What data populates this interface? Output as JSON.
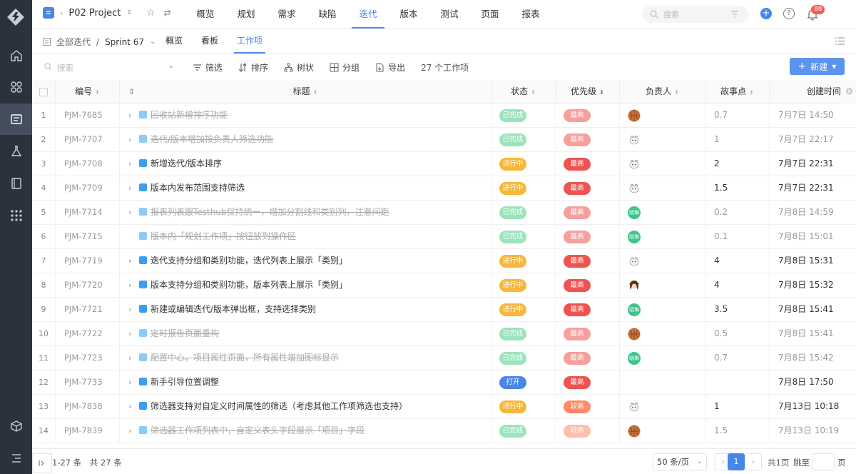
{
  "topbar": {
    "project_name": "P02 Project",
    "tabs": [
      "概览",
      "规划",
      "需求",
      "缺陷",
      "迭代",
      "版本",
      "测试",
      "页面",
      "报表"
    ],
    "active_tab": 4,
    "search_placeholder": "搜索",
    "notification_count": "88"
  },
  "subbar": {
    "breadcrumb_root": "全部迭代",
    "breadcrumb_sep": "/",
    "breadcrumb_current": "Sprint 67",
    "tabs": [
      "概览",
      "看板",
      "工作项"
    ],
    "active_tab": 2
  },
  "toolbar": {
    "search_placeholder": "搜索",
    "filter_label": "筛选",
    "sort_label": "排序",
    "tree_label": "树状",
    "group_label": "分组",
    "export_label": "导出",
    "count_text": "27 个工作项",
    "new_label": "新建"
  },
  "table": {
    "headers": {
      "code": "编号",
      "title": "标题",
      "status": "状态",
      "priority": "优先级",
      "assignee": "负责人",
      "points": "故事点",
      "created": "创建时间"
    },
    "status_colors": {
      "已完成": "#4ccf86",
      "进行中": "#f7b73c",
      "打开": "#4a86e8"
    },
    "priority_colors": {
      "最高": "#ef5350",
      "较高": "#ff8a65"
    },
    "rows": [
      {
        "idx": "1",
        "code": "PJM-7685",
        "title": "回收站新增排序功能",
        "done": true,
        "has_children": true,
        "status": "已完成",
        "priority": "最高",
        "assignee": "basketball",
        "points": "0.7",
        "created": "7月7日 14:50"
      },
      {
        "idx": "2",
        "code": "PJM-7707",
        "title": "迭代/版本增加按负责人筛选功能",
        "done": true,
        "has_children": true,
        "status": "已完成",
        "priority": "最高",
        "assignee": "sheep",
        "points": "1",
        "created": "7月7日 22:17"
      },
      {
        "idx": "3",
        "code": "PJM-7708",
        "title": "新增迭代/版本排序",
        "done": false,
        "has_children": true,
        "status": "进行中",
        "priority": "最高",
        "assignee": "sheep",
        "points": "2",
        "created": "7月7日 22:31"
      },
      {
        "idx": "4",
        "code": "PJM-7709",
        "title": "版本内发布范围支持筛选",
        "done": false,
        "has_children": true,
        "status": "进行中",
        "priority": "最高",
        "assignee": "sheep",
        "points": "1.5",
        "created": "7月7日 22:31"
      },
      {
        "idx": "5",
        "code": "PJM-7714",
        "title": "报表列表跟Testhub保持统一，增加分割线和类别列，注意间距",
        "done": true,
        "has_children": true,
        "status": "已完成",
        "priority": "最高",
        "assignee": "green",
        "avatar_text": "晓琳",
        "points": "0.2",
        "created": "7月8日 14:59"
      },
      {
        "idx": "6",
        "code": "PJM-7715",
        "title": "版本内「规划工作项」按钮放到操作区",
        "done": true,
        "has_children": false,
        "status": "已完成",
        "priority": "最高",
        "assignee": "green",
        "avatar_text": "晓琳",
        "points": "0.1",
        "created": "7月8日 15:01"
      },
      {
        "idx": "7",
        "code": "PJM-7719",
        "title": "迭代支持分组和类别功能，迭代列表上展示「类别」",
        "done": false,
        "has_children": true,
        "status": "进行中",
        "priority": "最高",
        "assignee": "sheep2",
        "points": "4",
        "created": "7月8日 15:31"
      },
      {
        "idx": "8",
        "code": "PJM-7720",
        "title": "版本支持分组和类别功能，版本列表上展示「类别」",
        "done": false,
        "has_children": true,
        "status": "进行中",
        "priority": "最高",
        "assignee": "girl",
        "points": "4",
        "created": "7月8日 15:32"
      },
      {
        "idx": "9",
        "code": "PJM-7721",
        "title": "新建或编辑迭代/版本弹出框，支持选择类别",
        "done": false,
        "has_children": true,
        "status": "进行中",
        "priority": "最高",
        "assignee": "green",
        "avatar_text": "晓琳",
        "points": "3.5",
        "created": "7月8日 15:41"
      },
      {
        "idx": "10",
        "code": "PJM-7722",
        "title": "定时报告页面重构",
        "done": true,
        "has_children": true,
        "status": "已完成",
        "priority": "最高",
        "assignee": "basketball",
        "points": "0.5",
        "created": "7月8日 15:41"
      },
      {
        "idx": "11",
        "code": "PJM-7723",
        "title": "配置中心，项目属性页面，所有属性增加图标显示",
        "done": true,
        "has_children": true,
        "status": "已完成",
        "priority": "最高",
        "assignee": "green",
        "avatar_text": "晓琳",
        "points": "0.7",
        "created": "7月8日 15:42"
      },
      {
        "idx": "12",
        "code": "PJM-7733",
        "title": "新手引导位置调整",
        "done": false,
        "has_children": true,
        "status": "打开",
        "priority": "最高",
        "assignee": "",
        "points": "",
        "created": "7月8日 17:50"
      },
      {
        "idx": "13",
        "code": "PJM-7838",
        "title": "筛选器支持对自定义时间属性的筛选（考虑其他工作项筛选也支持）",
        "done": false,
        "has_children": true,
        "status": "进行中",
        "priority": "较高",
        "assignee": "sheep",
        "points": "1",
        "created": "7月13日 10:18"
      },
      {
        "idx": "14",
        "code": "PJM-7839",
        "title": "筛选器工作项列表中，自定义表头字段展示「项目」字段",
        "done": true,
        "has_children": true,
        "status": "已完成",
        "priority": "较高",
        "assignee": "basketball",
        "points": "1.5",
        "created": "7月13日 10:19"
      }
    ]
  },
  "footer": {
    "range_text": "1-27 条　共 27 条",
    "page_size": "50 条/页",
    "current_page": "1",
    "total_pages": "共1页",
    "jump_label": "跳至",
    "page_suffix": "页"
  },
  "colors": {
    "accent": "#4a86e8",
    "rail": "#2b323c"
  }
}
